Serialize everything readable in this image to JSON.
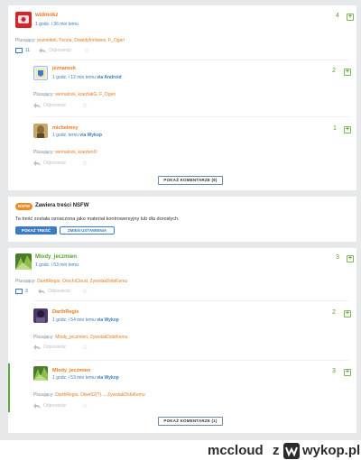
{
  "entry1": {
    "author": "widmokz",
    "time": "1 godz. i 36 min temu",
    "votes": "4",
    "tagged_label": "Plusujący:",
    "tagged_users": "pozneitek, Toczia, Dowidyforlowes, F_Ogeri",
    "comments_count": "11",
    "reply_label": "Odpowiedz",
    "colors": {
      "avatar": "#d8232a"
    }
  },
  "entry1_comments": [
    {
      "author": "jeznanezk",
      "time": "1 godz. i 12 min temu",
      "via": "via Android",
      "votes": "2",
      "tagged_label": "Plusujący:",
      "tagged_users": "wernalcek, koezlakG, F_Ogeri",
      "reply_label": "Odpowiedz",
      "avatar_color": "#7aa8d8"
    },
    {
      "author": "michelmey",
      "time": "1 godz. temu",
      "via": "via Wykop",
      "votes": "1",
      "tagged_label": "Plusujący:",
      "tagged_users": "wernalcek, koezlenO",
      "reply_label": "Odpowiedz",
      "avatar_color": "#c8a86a"
    }
  ],
  "entry1_more": "POKAŻ KOMENTARZE (9)",
  "nsfw": {
    "badge": "NSFW",
    "title": "Zawiera treści NSFW",
    "text": "Ta treść została oznaczona jako materiał kontrowersyjny lub dla dorosłych.",
    "show_btn": "POKAŻ TREŚĆ",
    "settings_btn": "ZMIEŃ USTAWIENIA"
  },
  "entry2": {
    "author": "Mlody_jeczmien",
    "time": "1 godz. i 53 min temu",
    "votes": "3",
    "tagged_label": "Plusujący:",
    "tagged_users": "DarthRegis, OrochiCloud, ZywolakDobiKemu",
    "comments_count": "3",
    "reply_label": "Odpowiedz"
  },
  "entry2_comments": [
    {
      "author": "DarthRegis",
      "time": "1 godz. i 54 min temu",
      "via": "via Wykop",
      "votes": "2",
      "tagged_label": "Plusujący:",
      "tagged_users": "Mlody_jeczmien, ZywolakDobiKemu",
      "reply_label": "Odpowiedz",
      "avatar_color": "#4a3a6a"
    },
    {
      "author": "Mlody_jeczmien",
      "time": "1 godz. i 53 min temu",
      "via": "via Wykop",
      "votes": "3",
      "tagged_label": "Plusujący:",
      "tagged_users": "DarthRegis, Olwe52(?)..., ZywolakDobiKemu",
      "reply_label": "Odpowiedz",
      "avatar_color": "#6a9a3a"
    }
  ],
  "entry2_more": "POKAŻ KOMENTARZE (1)",
  "footer": {
    "username": "mccloud",
    "z": "z",
    "site": "wykop.pl"
  }
}
